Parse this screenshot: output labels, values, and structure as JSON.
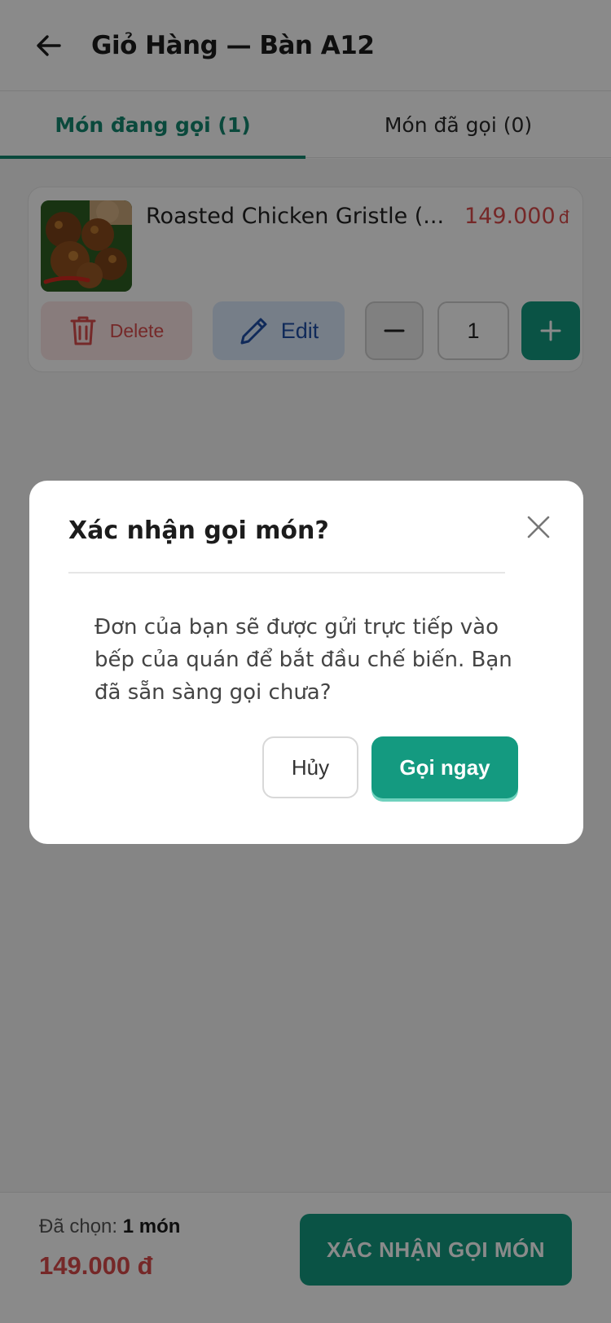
{
  "header": {
    "title": "Giỏ Hàng — Bàn A12",
    "back_icon": "arrow-left-icon"
  },
  "tabs": [
    {
      "label": "Món đang gọi (1)",
      "active": true
    },
    {
      "label": "Món đã gọi (0)",
      "active": false
    }
  ],
  "cart": {
    "items": [
      {
        "name": "Roasted Chicken Gristle (...",
        "price": "149.000",
        "currency": "đ",
        "quantity": "1",
        "delete_label": "Delete",
        "edit_label": "Edit"
      }
    ]
  },
  "footer": {
    "selected_label": "Đã chọn:",
    "selected_value": "1 món",
    "total": "149.000 đ",
    "confirm_label": "XÁC NHẬN GỌI MÓN"
  },
  "modal": {
    "title": "Xác nhận gọi món?",
    "message": "Đơn của bạn sẽ được gửi trực tiếp vào bếp của quán để bắt đầu chế biến. Bạn đã sẵn sàng gọi chưa?",
    "cancel_label": "Hủy",
    "confirm_label": "Gọi ngay"
  },
  "colors": {
    "accent": "#149a80",
    "price": "#d94b4b",
    "delete_bg": "#fbe6e6",
    "edit_bg": "#dbe9fb"
  }
}
